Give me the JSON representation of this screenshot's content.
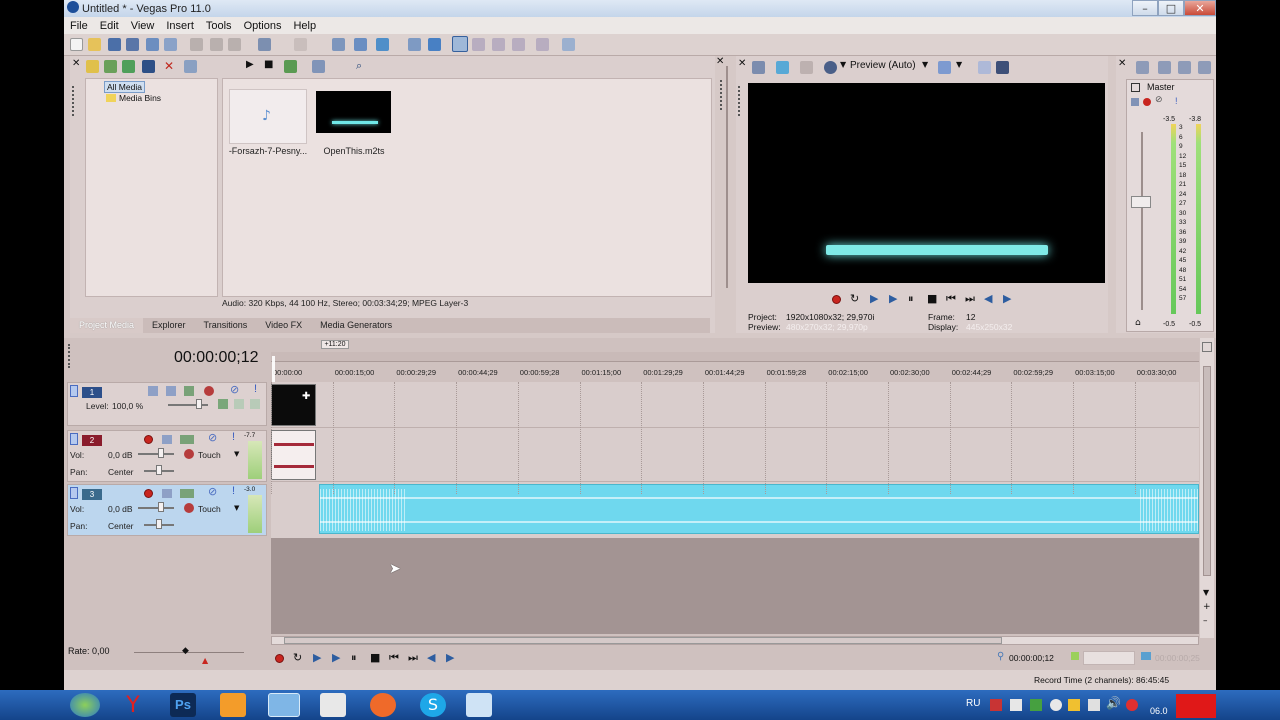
{
  "window": {
    "title": "Untitled * - Vegas Pro 11.0"
  },
  "menu": [
    "File",
    "Edit",
    "View",
    "Insert",
    "Tools",
    "Options",
    "Help"
  ],
  "media": {
    "tree": [
      "All Media",
      "Media Bins"
    ],
    "items": [
      {
        "caption": "-Forsazh-7-Pesny..."
      },
      {
        "caption": "OpenThis.m2ts"
      }
    ],
    "info": "Audio: 320 Kbps, 44 100 Hz, Stereo; 00:03:34;29; MPEG Layer-3"
  },
  "tabs": [
    "Project Media",
    "Explorer",
    "Transitions",
    "Video FX",
    "Media Generators"
  ],
  "preview": {
    "mode": "Preview (Auto)",
    "project_label": "Project:",
    "project_value": "1920x1080x32; 29,970i",
    "preview_label": "Preview:",
    "preview_value": "480x270x32; 29,970p",
    "frame_label": "Frame:",
    "frame_value": "12",
    "display_label": "Display:",
    "display_value": "445x250x32"
  },
  "mixer": {
    "title": "Master",
    "left_peak": "-3.5",
    "right_peak": "-3.8",
    "scale": [
      "3",
      "6",
      "9",
      "12",
      "15",
      "18",
      "21",
      "24",
      "27",
      "30",
      "33",
      "36",
      "39",
      "42",
      "45",
      "48",
      "51",
      "54",
      "57"
    ],
    "bottom_left": "-0.5",
    "bottom_right": "-0.5"
  },
  "timeline": {
    "timecode": "00:00:00;12",
    "loop_marker": "+11:20",
    "ruler": [
      "00:00:00",
      "00:00:15;00",
      "00:00:29;29",
      "00:00:44;29",
      "00:00:59;28",
      "00:01:15;00",
      "00:01:29;29",
      "00:01:44;29",
      "00:01:59;28",
      "00:02:15;00",
      "00:02:30;00",
      "00:02:44;29",
      "00:02:59;29",
      "00:03:15;00",
      "00:03:30;00"
    ],
    "tracks": [
      {
        "num": "1",
        "level_label": "Level:",
        "level_value": "100,0 %"
      },
      {
        "num": "2",
        "vol_label": "Vol:",
        "vol_value": "0,0 dB",
        "pan_label": "Pan:",
        "pan_value": "Center",
        "mode": "Touch",
        "meter": "-7.7"
      },
      {
        "num": "3",
        "vol_label": "Vol:",
        "vol_value": "0,0 dB",
        "pan_label": "Pan:",
        "pan_value": "Center",
        "mode": "Touch",
        "meter": "-3.0"
      }
    ],
    "rate": "Rate: 0,00",
    "position": "00:00:00;12",
    "length": "00:00:00;25"
  },
  "status": {
    "record_time": "Record Time (2 channels): 86:45:45"
  },
  "taskbar": {
    "lang": "RU",
    "clock": "06.0"
  },
  "colors": {
    "audio_clip": "#6fd8ee",
    "waveform": "#ffffff",
    "video_track": "#2c4f8a",
    "audio_track_2": "#8a1c2c",
    "title_bar": "#c4d5ea"
  }
}
